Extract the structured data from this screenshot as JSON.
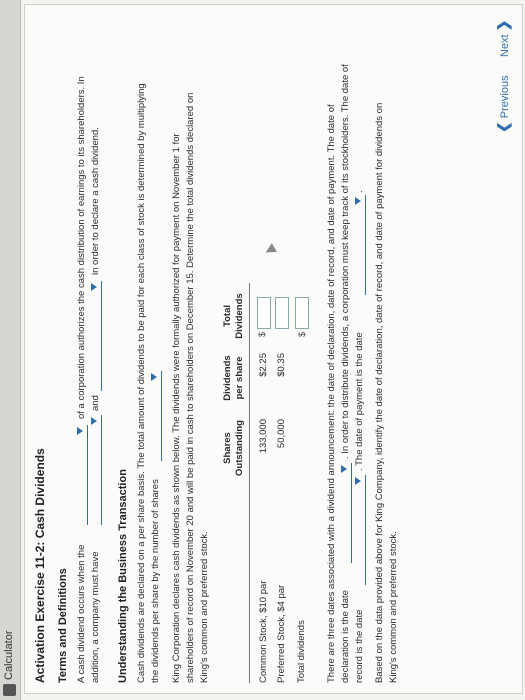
{
  "app": {
    "calculator_label": "Calculator"
  },
  "exercise": {
    "title": "Activation Exercise 11-2: Cash Dividends"
  },
  "terms": {
    "heading": "Terms and Definitions",
    "line1a": "A cash dividend occurs when the",
    "line1b": "of a corporation authorizes the cash distribution of earnings to its shareholders. In",
    "line2a": "addition, a company must have",
    "line2b": "and",
    "line2c": "in order to declare a cash dividend."
  },
  "understanding": {
    "heading": "Understanding the Business Transaction",
    "p1a": "Cash dividends are declared on a per share basis. The total amount of dividends to be paid for each class of stock is determined by multiplying",
    "p1b": "the dividends per share by the number of shares",
    "p2a": "King Corporation declares cash dividends as shown below. The dividends were formally authorized for payment on November 1 for",
    "p2b": "shareholders of record on November 20 and will be paid in cash to shareholders on December 15. Determine the total dividends declared on",
    "p2c": "King's common and preferred stock."
  },
  "table": {
    "headers": {
      "shares": [
        "Shares",
        "Outstanding"
      ],
      "dividends": [
        "Dividends",
        "per share"
      ],
      "total": [
        "Total",
        "Dividends"
      ]
    },
    "rows": [
      {
        "label": "Common Stock, $10 par",
        "shares": "133,000",
        "per_share": "$2.25",
        "currency": "$"
      },
      {
        "label": "Preferred Stock, $4 par",
        "shares": "50,000",
        "per_share": "$0.35",
        "currency": ""
      }
    ],
    "total_label": "Total dividends",
    "total_currency": "$"
  },
  "dates": {
    "p1a": "There are three dates associated with a dividend announcement: the date of declaration, date of record, and date of payment. The date of",
    "p1b": "declaration is the date",
    "p1c": ". In order to distribute dividends, a corporation must keep track of its stockholders. The date of",
    "p1d": "record is the date",
    "p1e": ". The date of payment is the date",
    "p1f": ".",
    "p2a": "Based on the data provided above for King Company, identify the date of declaration, date of record, and date of payment for dividends on",
    "p2b": "King's common and preferred stock."
  },
  "nav": {
    "previous": "Previous",
    "next": "Next"
  }
}
